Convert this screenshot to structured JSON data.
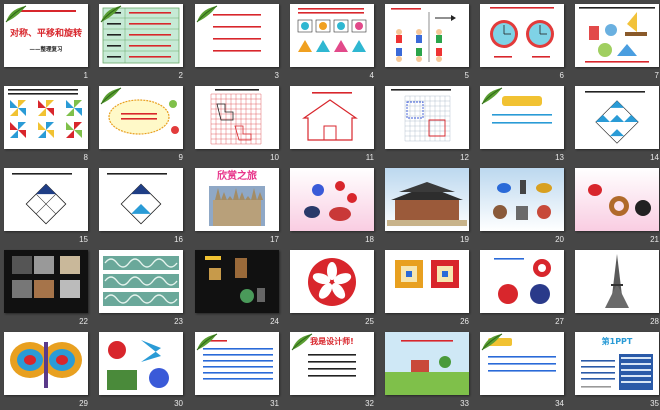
{
  "slide_sorter": {
    "slides": [
      {
        "number": "1",
        "title": "对称、平移和旋转",
        "subtitle": "——整理复习",
        "bg": "#ffffff"
      },
      {
        "number": "2",
        "bg": "#ffffff"
      },
      {
        "number": "3",
        "bg": "#ffffff"
      },
      {
        "number": "4",
        "bg": "#ffffff"
      },
      {
        "number": "5",
        "bg": "#ffffff"
      },
      {
        "number": "6",
        "bg": "#ffffff"
      },
      {
        "number": "7",
        "bg": "#ffffff"
      },
      {
        "number": "8",
        "bg": "#ffffff"
      },
      {
        "number": "9",
        "bg": "#ffffff"
      },
      {
        "number": "10",
        "bg": "#ffffff"
      },
      {
        "number": "11",
        "bg": "#ffffff"
      },
      {
        "number": "12",
        "bg": "#ffffff"
      },
      {
        "number": "13",
        "bg": "#ffffff"
      },
      {
        "number": "14",
        "bg": "#ffffff"
      },
      {
        "number": "15",
        "bg": "#ffffff"
      },
      {
        "number": "16",
        "bg": "#ffffff"
      },
      {
        "number": "17",
        "title": "欣赏之旅",
        "bg": "#ffffff"
      },
      {
        "number": "18",
        "bg": "#fbe1ee"
      },
      {
        "number": "19",
        "bg": "#cfe3f3"
      },
      {
        "number": "20",
        "bg": "#cfe3f3"
      },
      {
        "number": "21",
        "bg": "#fbe1ee"
      },
      {
        "number": "22",
        "bg": "#111111"
      },
      {
        "number": "23",
        "bg": "#ffffff"
      },
      {
        "number": "24",
        "bg": "#111111"
      },
      {
        "number": "25",
        "bg": "#ffffff"
      },
      {
        "number": "26",
        "bg": "#ffffff"
      },
      {
        "number": "27",
        "bg": "#ffffff"
      },
      {
        "number": "28",
        "bg": "#ffffff"
      },
      {
        "number": "29",
        "bg": "#ffffff"
      },
      {
        "number": "30",
        "bg": "#ffffff"
      },
      {
        "number": "31",
        "bg": "#ffffff"
      },
      {
        "number": "32",
        "title": "我是设计师!",
        "bg": "#ffffff"
      },
      {
        "number": "33",
        "bg": "#ffffff"
      },
      {
        "number": "34",
        "bg": "#ffffff"
      },
      {
        "number": "35",
        "title": "第1PPT",
        "bg": "#ffffff"
      }
    ]
  },
  "colors": {
    "background": "#464646",
    "slide_number": "#e8e8e8",
    "leaf_green": "#4a8c2a",
    "accent_red": "#d8262c",
    "accent_blue": "#2a9bd6"
  }
}
